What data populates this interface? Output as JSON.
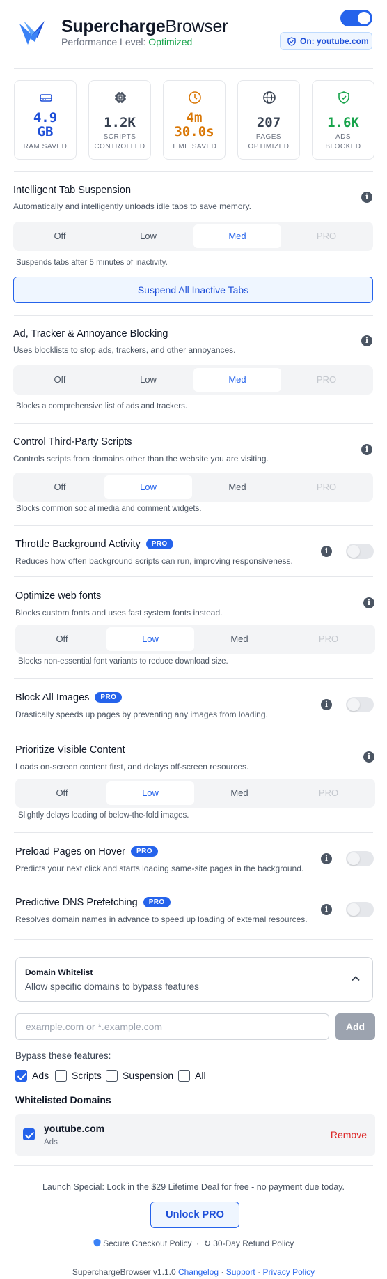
{
  "header": {
    "brand_bold": "Supercharge",
    "brand_rest": "Browser",
    "perf_label": "Performance Level:",
    "perf_value": "Optimized",
    "site_badge": "On: youtube.com",
    "accent": "#2563eb"
  },
  "stats": [
    {
      "icon": "memory-icon",
      "value": "4.9\nGB",
      "label": "RAM SAVED",
      "color": "#1d4ed8"
    },
    {
      "icon": "chip-icon",
      "value": "1.2K",
      "label": "SCRIPTS\nCONTROLLED",
      "color": "#374151"
    },
    {
      "icon": "clock-icon",
      "value": "4m\n30.0s",
      "label": "TIME SAVED",
      "color": "#d97706"
    },
    {
      "icon": "globe-icon",
      "value": "207",
      "label": "PAGES\nOPTIMIZED",
      "color": "#374151"
    },
    {
      "icon": "shield-check-icon",
      "value": "1.6K",
      "label": "ADS\nBLOCKED",
      "color": "#16a34a"
    }
  ],
  "seg_options": [
    "Off",
    "Low",
    "Med",
    "PRO"
  ],
  "tab_suspension": {
    "title": "Intelligent Tab Suspension",
    "desc": "Automatically and intelligently unloads idle tabs to save memory.",
    "selected": "Med",
    "note": "Suspends tabs after 5 minutes of inactivity.",
    "button": "Suspend All Inactive Tabs"
  },
  "ad_blocking": {
    "title": "Ad, Tracker & Annoyance Blocking",
    "desc": "Uses blocklists to stop ads, trackers, and other annoyances.",
    "selected": "Med",
    "note": "Blocks a comprehensive list of ads and trackers."
  },
  "third_party": {
    "title": "Control Third-Party Scripts",
    "desc": "Controls scripts from domains other than the website you are visiting.",
    "selected": "Low",
    "note": "Blocks common social media and comment widgets."
  },
  "throttle": {
    "title": "Throttle Background Activity",
    "badge": "PRO",
    "desc": "Reduces how often background scripts can run, improving responsiveness.",
    "enabled": false
  },
  "web_fonts": {
    "title": "Optimize web fonts",
    "desc": "Blocks custom fonts and uses fast system fonts instead.",
    "selected": "Low",
    "note": "Blocks non-essential font variants to reduce download size."
  },
  "block_images": {
    "title": "Block All Images",
    "badge": "PRO",
    "desc": "Drastically speeds up pages by preventing any images from loading.",
    "enabled": false
  },
  "visible_content": {
    "title": "Prioritize Visible Content",
    "desc": "Loads on-screen content first, and delays off-screen resources.",
    "selected": "Low",
    "note": "Slightly delays loading of below-the-fold images."
  },
  "preload": {
    "title": "Preload Pages on Hover",
    "badge": "PRO",
    "desc": "Predicts your next click and starts loading same-site pages in the background.",
    "enabled": false
  },
  "dns": {
    "title": "Predictive DNS Prefetching",
    "badge": "PRO",
    "desc": "Resolves domain names in advance to speed up loading of external resources.",
    "enabled": false
  },
  "whitelist": {
    "title": "Domain Whitelist",
    "desc": "Allow specific domains to bypass features",
    "input_placeholder": "example.com or *.example.com",
    "add_label": "Add",
    "bypass_label": "Bypass these features:",
    "bypass_options": [
      {
        "label": "Ads",
        "checked": true
      },
      {
        "label": "Scripts",
        "checked": false
      },
      {
        "label": "Suspension",
        "checked": false
      },
      {
        "label": "All",
        "checked": false
      }
    ],
    "list_title": "Whitelisted Domains",
    "entries": [
      {
        "domain": "youtube.com",
        "features": "Ads",
        "remove_label": "Remove",
        "checked": true
      }
    ]
  },
  "promo": {
    "text": "Launch Special: Lock in the $29 Lifetime Deal for free - no payment due today.",
    "button": "Unlock PRO",
    "secure": "Secure Checkout Policy",
    "refund": "30-Day Refund Policy"
  },
  "footer": {
    "version": "SuperchargeBrowser v1.1.0",
    "changelog": "Changelog",
    "support": "Support",
    "privacy": "Privacy Policy",
    "sep": "·"
  }
}
